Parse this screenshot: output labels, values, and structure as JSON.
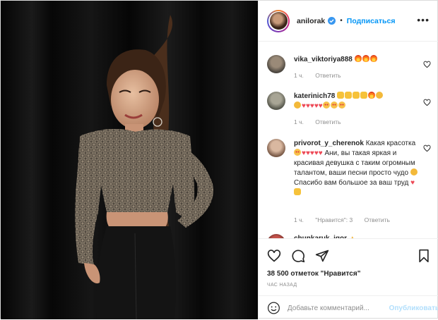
{
  "post": {
    "username": "anilorak",
    "follow_label": "Подписаться",
    "more_label": "•••"
  },
  "comments": [
    {
      "username": "vika_viktoriya888",
      "text": "",
      "emojis": [
        "fire",
        "fire",
        "fire"
      ],
      "time": "1 ч.",
      "reply_label": "Ответить"
    },
    {
      "username": "katerinich78",
      "text": "",
      "emojis": [
        "pray",
        "pray",
        "pray",
        "pray",
        "fire",
        "clap",
        "clap",
        "heart",
        "heart",
        "heart",
        "heart",
        "heart",
        "love",
        "love",
        "love"
      ],
      "time": "1 ч.",
      "reply_label": "Ответить"
    },
    {
      "username": "privorot_y_cherenok",
      "text_1": "Какая красотка",
      "text_2": "Ани, вы такая яркая и красивая девушка с таким огромным талантом, ваши песни просто чудо",
      "text_3": "Спасибо вам большое за ваш труд",
      "time": "1 ч.",
      "likes_label": "\"Нравится\": 3",
      "reply_label": "Ответить"
    },
    {
      "username": "chunkaruk_igor"
    }
  ],
  "actions": {
    "likes_text": "38 500 отметок \"Нравится\"",
    "time_text": "ЧАС НАЗАД",
    "comment_placeholder": "Добавьте комментарий...",
    "publish_label": "Опубликовать"
  },
  "colors": {
    "accent": "#0095f6",
    "muted": "#8e8e8e",
    "publish_disabled": "#b2dffc",
    "heart_red": "#ed4956"
  }
}
